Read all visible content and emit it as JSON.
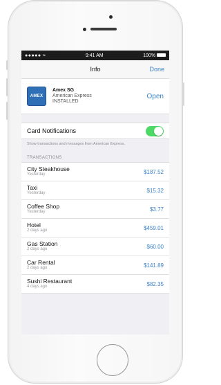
{
  "status_bar": {
    "signal": "●●●●● ≈",
    "time": "9:41 AM",
    "battery": "100%"
  },
  "nav": {
    "title": "Info",
    "done_label": "Done"
  },
  "card": {
    "logo_text": "AMEX",
    "name": "Amex SG",
    "issuer": "American Express",
    "status": "INSTALLED",
    "open_label": "Open"
  },
  "notifications": {
    "label": "Card Notifications",
    "enabled": true,
    "help": "Show transactions and messages from American Express."
  },
  "transactions": {
    "header": "TRANSACTIONS",
    "items": [
      {
        "merchant": "City Steakhouse",
        "date": "Yesterday",
        "amount": "$187.52"
      },
      {
        "merchant": "Taxi",
        "date": "Yesterday",
        "amount": "$15.32"
      },
      {
        "merchant": "Coffee Shop",
        "date": "Yesterday",
        "amount": "$3.77"
      },
      {
        "merchant": "Hotel",
        "date": "2 days ago",
        "amount": "$459.01"
      },
      {
        "merchant": "Gas Station",
        "date": "2 days ago",
        "amount": "$60.00"
      },
      {
        "merchant": "Car Rental",
        "date": "2 days ago",
        "amount": "$141.89"
      },
      {
        "merchant": "Sushi Restaurant",
        "date": "4 days ago",
        "amount": "$82.35"
      }
    ]
  },
  "colors": {
    "accent": "#3b82c8",
    "toggle_on": "#4cd964",
    "amex_blue": "#2f6fb6"
  }
}
